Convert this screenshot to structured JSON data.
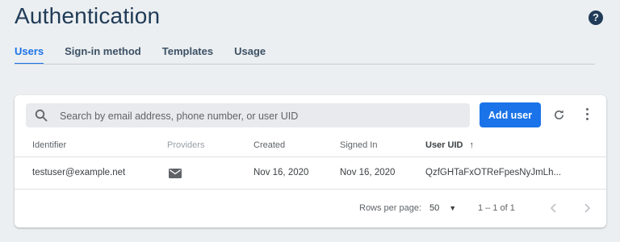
{
  "header": {
    "title": "Authentication",
    "help_icon": "help-circle-icon",
    "help_glyph": "?"
  },
  "tabs": [
    {
      "label": "Users",
      "active": true
    },
    {
      "label": "Sign-in method",
      "active": false
    },
    {
      "label": "Templates",
      "active": false
    },
    {
      "label": "Usage",
      "active": false
    }
  ],
  "toolbar": {
    "search_placeholder": "Search by email address, phone number, or user UID",
    "search_value": "",
    "add_user_label": "Add user",
    "refresh_icon": "refresh-icon",
    "more_icon": "more-vert-icon"
  },
  "table": {
    "columns": [
      "Identifier",
      "Providers",
      "Created",
      "Signed In",
      "User UID"
    ],
    "sort_indicator": "↑",
    "rows": [
      {
        "identifier": "testuser@example.net",
        "provider_icon": "email-icon",
        "created": "Nov 16, 2020",
        "signed_in": "Nov 16, 2020",
        "uid": "QzfGHTaFxOTReFpesNyJmLh..."
      }
    ]
  },
  "pagination": {
    "rows_per_page_label": "Rows per page:",
    "rows_per_page_value": "50",
    "range": "1 – 1 of 1"
  },
  "colors": {
    "accent": "#1a73e8",
    "title": "#1f3b57",
    "background": "#eceff1"
  }
}
